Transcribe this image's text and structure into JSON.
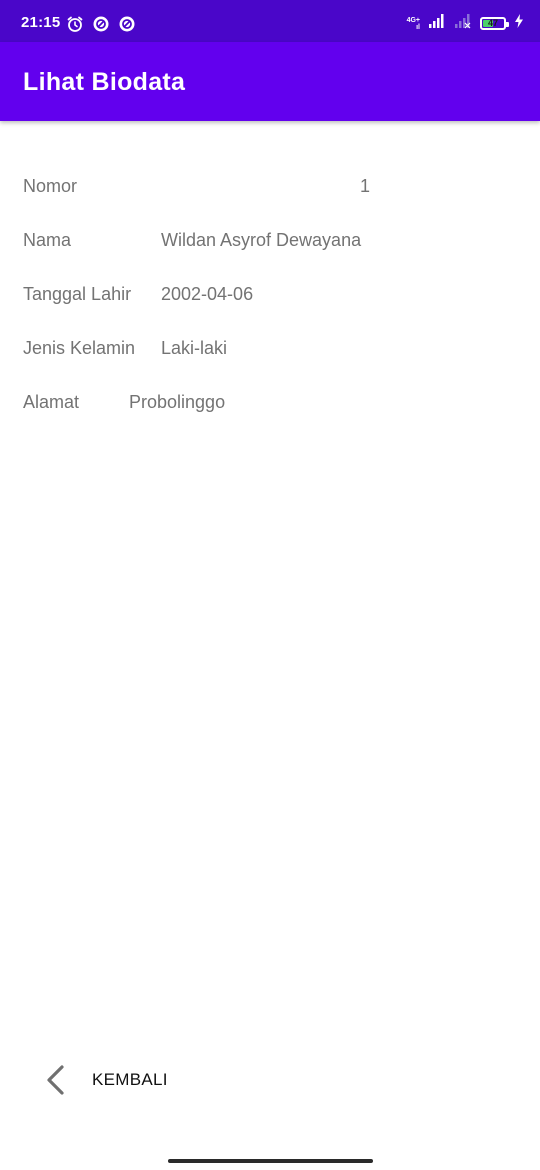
{
  "status_bar": {
    "time": "21:15",
    "network_label": "4G+",
    "network_sub": "ıl",
    "battery_level": "47",
    "icons": [
      "alarm-icon",
      "vpn-icon",
      "vpn-icon",
      "signal-icon",
      "signal-icon",
      "battery-icon",
      "charging-icon"
    ],
    "background_color": "#4a06c9"
  },
  "app_bar": {
    "title": "Lihat Biodata",
    "background_color": "#6200ee"
  },
  "biodata": {
    "nomor": {
      "label": "Nomor",
      "value": "1"
    },
    "nama": {
      "label": "Nama",
      "value": "Wildan Asyrof Dewayana"
    },
    "tanggal_lahir": {
      "label": "Tanggal Lahir",
      "value": "2002-04-06"
    },
    "jenis_kelamin": {
      "label": "Jenis Kelamin",
      "value": "Laki-laki"
    },
    "alamat": {
      "label": "Alamat",
      "value": "Probolinggo"
    }
  },
  "back_button": {
    "label": "KEMBALI",
    "icon": "chevron-left-icon"
  }
}
